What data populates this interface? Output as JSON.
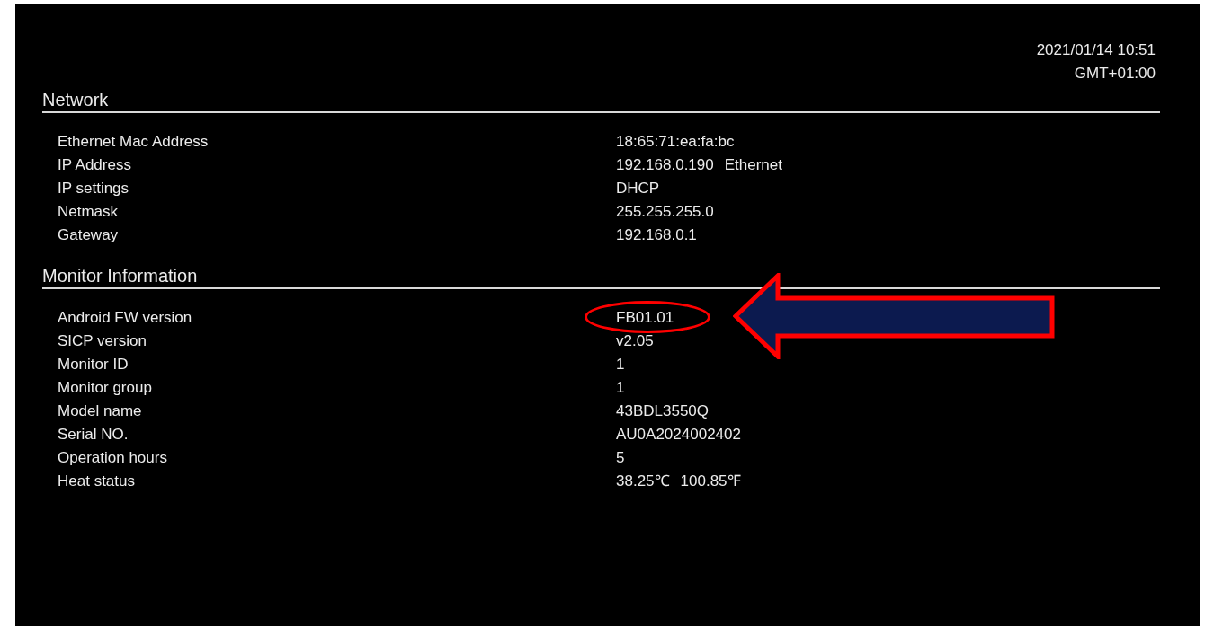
{
  "clock": {
    "date_time": "2021/01/14 10:51",
    "timezone": "GMT+01:00"
  },
  "sections": [
    {
      "title": "Network",
      "rows": [
        {
          "label": "Ethernet Mac Address",
          "values": [
            "18:65:71:ea:fa:bc"
          ],
          "highlighted": false
        },
        {
          "label": "IP Address",
          "values": [
            "192.168.0.190",
            "Ethernet"
          ],
          "highlighted": false
        },
        {
          "label": "IP settings",
          "values": [
            "DHCP"
          ],
          "highlighted": false
        },
        {
          "label": "Netmask",
          "values": [
            "255.255.255.0"
          ],
          "highlighted": false
        },
        {
          "label": "Gateway",
          "values": [
            "192.168.0.1"
          ],
          "highlighted": false
        }
      ]
    },
    {
      "title": "Monitor Information",
      "rows": [
        {
          "label": "Android FW version",
          "values": [
            "FB01.01"
          ],
          "highlighted": true
        },
        {
          "label": "SICP version",
          "values": [
            "v2.05"
          ],
          "highlighted": false
        },
        {
          "label": "Monitor ID",
          "values": [
            "1"
          ],
          "highlighted": false
        },
        {
          "label": "Monitor group",
          "values": [
            "1"
          ],
          "highlighted": false
        },
        {
          "label": "Model name",
          "values": [
            "43BDL3550Q"
          ],
          "highlighted": false
        },
        {
          "label": "Serial NO.",
          "values": [
            "AU0A2024002402"
          ],
          "highlighted": false
        },
        {
          "label": "Operation hours",
          "values": [
            "5"
          ],
          "highlighted": false
        },
        {
          "label": "Heat status",
          "values": [
            "38.25℃",
            "100.85℉"
          ],
          "highlighted": false
        }
      ]
    }
  ]
}
